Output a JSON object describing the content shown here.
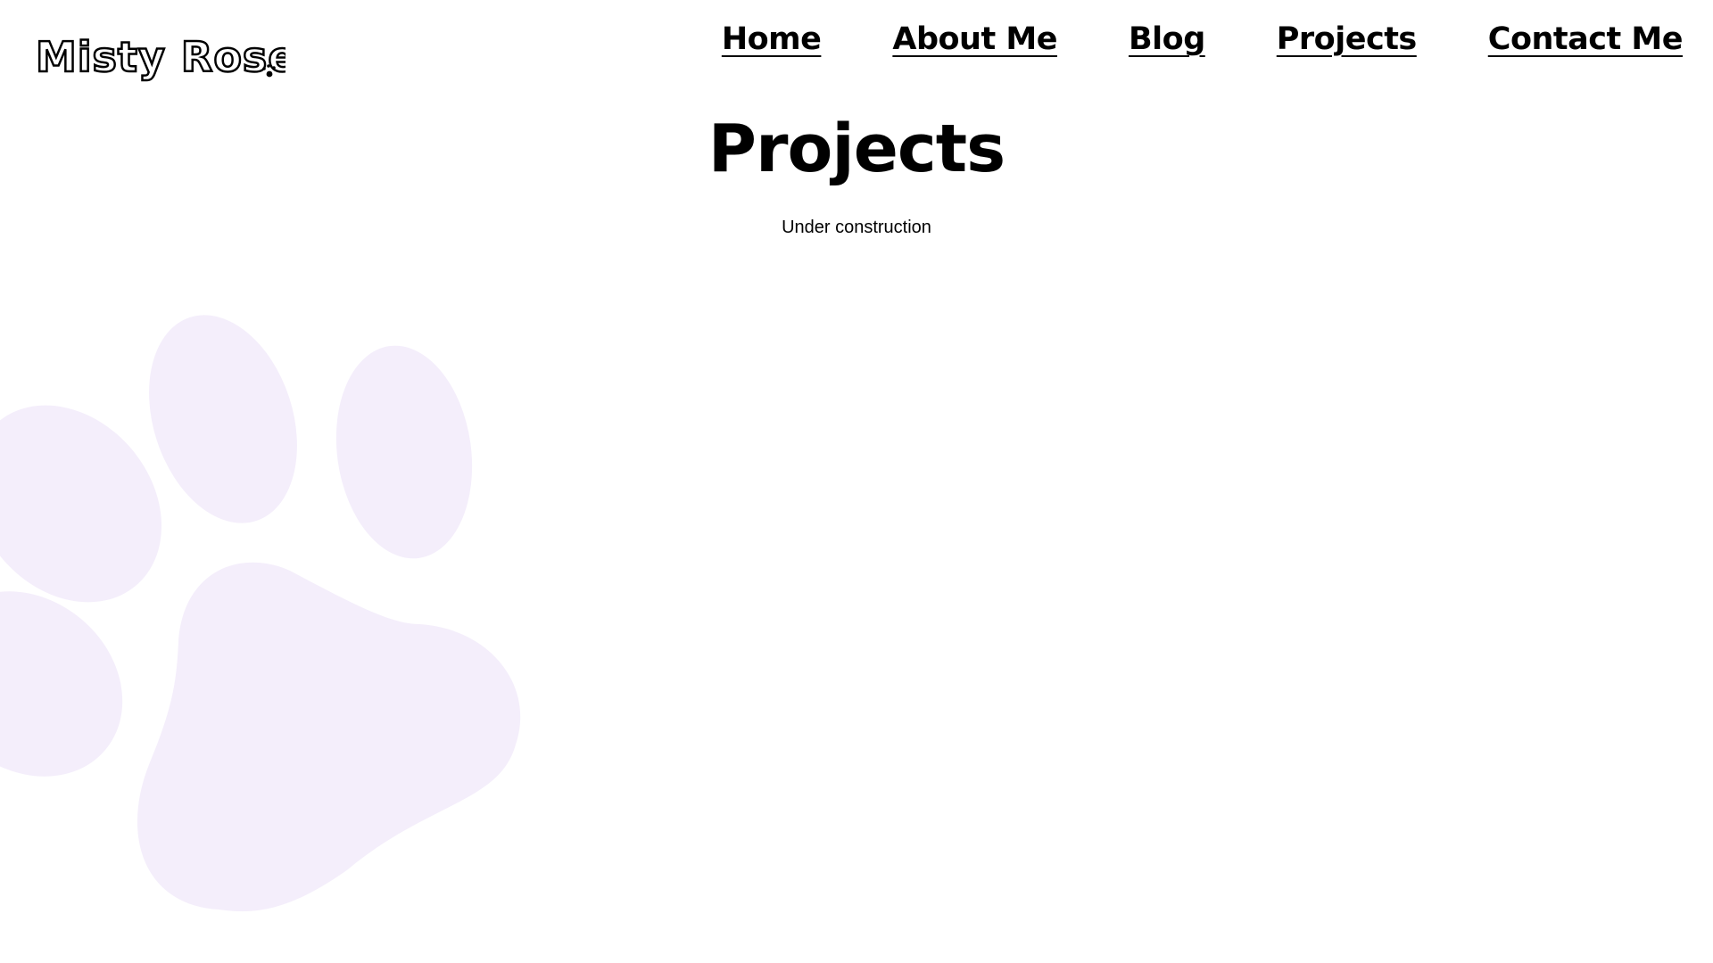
{
  "header": {
    "logo_text": "Misty Rose!",
    "logo_icon": "paw-icon"
  },
  "nav": {
    "items": [
      {
        "label": "Home"
      },
      {
        "label": "About Me"
      },
      {
        "label": "Blog"
      },
      {
        "label": "Projects"
      },
      {
        "label": "Contact Me"
      }
    ]
  },
  "main": {
    "title": "Projects",
    "subtitle": "Under construction"
  },
  "decoration": {
    "background_icon": "paw-print-icon",
    "paw_color": "#f4eefb"
  },
  "colors": {
    "background": "#ffffff",
    "text": "#000000"
  }
}
